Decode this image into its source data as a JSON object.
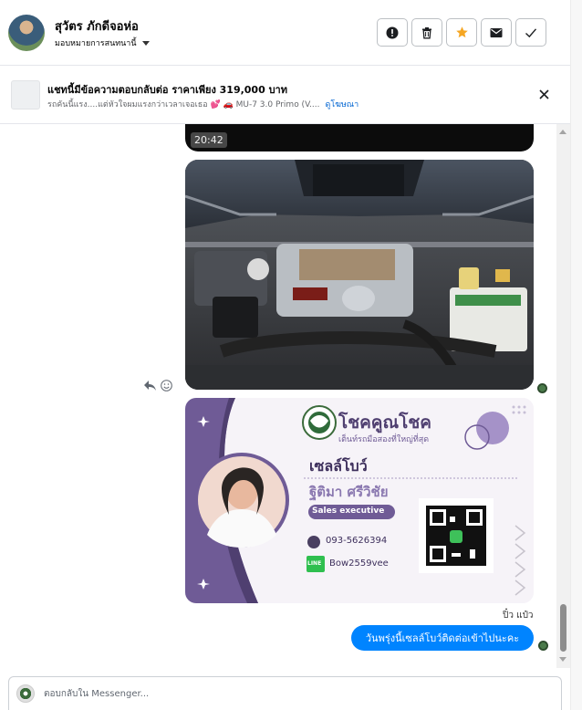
{
  "header": {
    "contact_name": "สุวัตร ภักดีจอห่อ",
    "assign_label": "มอบหมายการสนทนานี้",
    "action_icons": [
      "alert-icon",
      "trash-icon",
      "star-icon",
      "mail-icon",
      "check-icon"
    ],
    "star_color": "#f5a623"
  },
  "banner": {
    "title": "แชทนี้มีข้อความตอบกลับต่อ ราคาเพียง 319,000 บาท",
    "subtitle_text": "รถคันนี้แรง....แต่หัวใจผมแรงกว่าเวลาเจอเธอ 💕 🚗 MU-7 3.0 Primo (V....",
    "subtitle_link": "ดูโฆษณา"
  },
  "thread": {
    "video_time": "20:42",
    "card": {
      "brand": "โชคคูณโชค",
      "tagline": "เต็นท์รถมือสองที่ใหญ่ที่สุด",
      "role_line": "เซลล์โบว์",
      "person_name": "ฐิติมา ศรีวิชัย",
      "position": "Sales executive",
      "phone": "093-5626394",
      "line_badge": "LINE",
      "line_id": "Bow2559vee"
    },
    "sender_name": "ปิ๋ว แป๋ว",
    "last_message": "วันพรุ่งนี้เซลล์โบว์ติดต่อเข้าไปนะคะ"
  },
  "composer": {
    "placeholder": "ตอบกลับใน Messenger..."
  },
  "colors": {
    "bubble": "#0084ff",
    "card_purple": "#6f5b96",
    "link": "#0064d1"
  }
}
